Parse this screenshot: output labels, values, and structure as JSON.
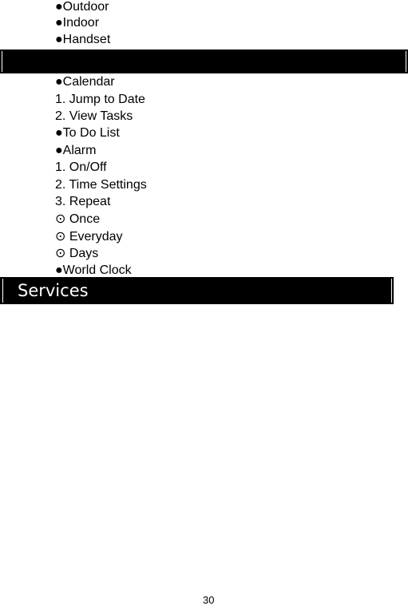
{
  "lines_top": [
    "●Outdoor",
    "●Indoor",
    "●Handset"
  ],
  "section_bar_1": {
    "title": ""
  },
  "lines_mid": [
    "●Calendar",
    "1. Jump to Date",
    "2. View Tasks",
    "●To Do List",
    "●Alarm",
    "1. On/Off",
    "2. Time Settings",
    "3. Repeat",
    "⊙ Once",
    "⊙ Everyday",
    "⊙ Days",
    "●World Clock"
  ],
  "section_bar_2": {
    "title": "Services"
  },
  "page_number": "30"
}
